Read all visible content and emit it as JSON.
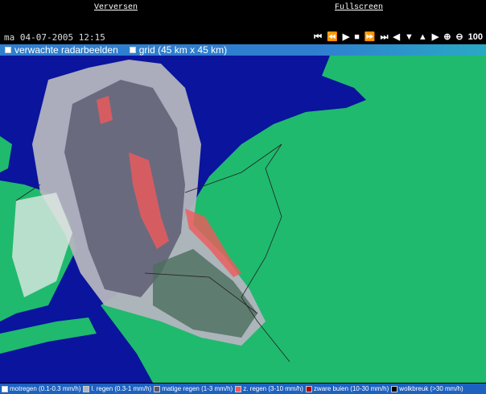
{
  "links": {
    "refresh": "Verversen",
    "fullscreen": "Fullscreen"
  },
  "datetime": "ma 04-07-2005 12:15",
  "controls": [
    {
      "name": "first-frame",
      "glyph": "⏮"
    },
    {
      "name": "rewind",
      "glyph": "⏪"
    },
    {
      "name": "play",
      "glyph": "▶"
    },
    {
      "name": "stop",
      "glyph": "■"
    },
    {
      "name": "fast-forward",
      "glyph": "⏩"
    },
    {
      "name": "last-frame",
      "glyph": "⏭"
    },
    {
      "name": "pan-left",
      "glyph": "◀"
    },
    {
      "name": "pan-down",
      "glyph": "▼"
    },
    {
      "name": "pan-up",
      "glyph": "▲"
    },
    {
      "name": "pan-right",
      "glyph": "▶"
    },
    {
      "name": "zoom-in",
      "glyph": "⊕"
    },
    {
      "name": "zoom-out",
      "glyph": "⊖"
    }
  ],
  "zoom_level": "100",
  "options": {
    "forecast": "verwachte radarbeelden",
    "grid": "grid (45 km x 45 km)"
  },
  "legend": [
    {
      "label": "motregen (0.1-0.3 mm/h)",
      "color": "#ffffff"
    },
    {
      "label": "l. regen (0.3-1 mm/h)",
      "color": "#b4b4be"
    },
    {
      "label": "matige regen (1-3 mm/h)",
      "color": "#5a5a6e"
    },
    {
      "label": "z. regen (3-10 mm/h)",
      "color": "#f05a5a"
    },
    {
      "label": "zware buien (10-30 mm/h)",
      "color": "#b40000"
    },
    {
      "label": "wolkbreuk (>30 mm/h)",
      "color": "#000000"
    }
  ],
  "colors": {
    "sea": "#0a149c",
    "land": "#1fba6e",
    "rain_light": "#b4b4be",
    "rain_moderate": "#6a6a7e",
    "rain_heavy": "#f05a5a"
  }
}
